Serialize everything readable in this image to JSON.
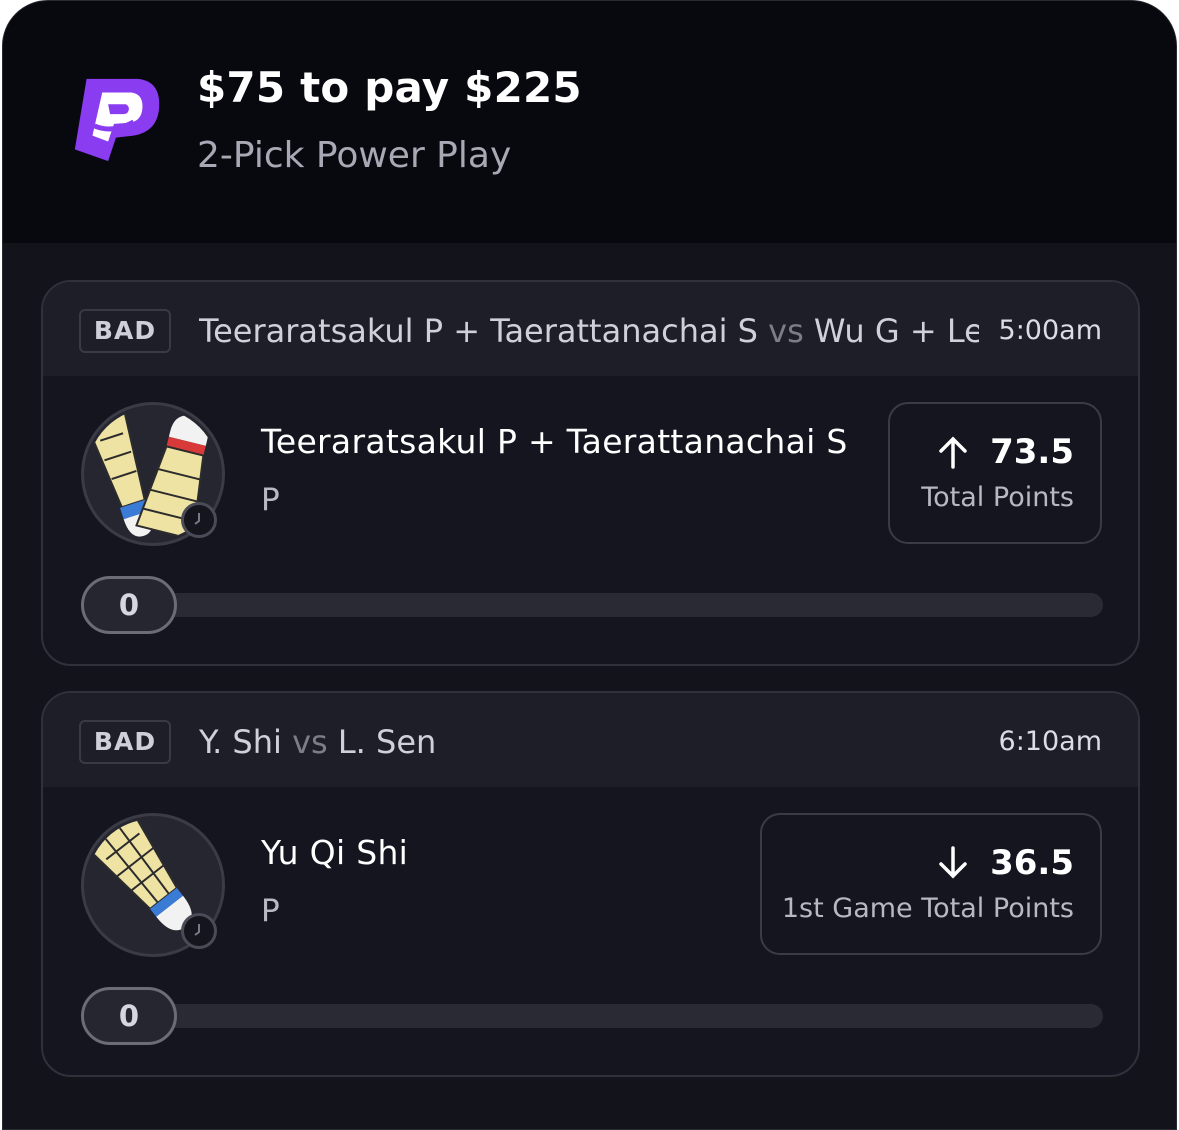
{
  "entry": {
    "title": "$75 to pay $225",
    "subtitle": "2-Pick Power Play"
  },
  "picks": [
    {
      "sport": "BAD",
      "team_a": "Teeraratsakul P + Taerattanachai S",
      "vs": "vs",
      "team_b": "Wu G + Le",
      "time": "5:00am",
      "player": "Teeraratsakul P + Taerattanachai S",
      "position": "P",
      "direction": "up",
      "line": "73.5",
      "stat": "Total Points",
      "progress": "0",
      "progress_fraction": 0
    },
    {
      "sport": "BAD",
      "team_a": "Y. Shi",
      "vs": "vs",
      "team_b": "L. Sen",
      "time": "6:10am",
      "player": "Yu Qi Shi",
      "position": "P",
      "direction": "down",
      "line": "36.5",
      "stat": "1st Game Total Points",
      "progress": "0",
      "progress_fraction": 0
    }
  ],
  "colors": {
    "brand": "#8a3cf0",
    "background": "#13131c",
    "header": "#08080f"
  },
  "icons": [
    "prizepicks-logo-icon",
    "shuttlecock-icon",
    "clock-icon",
    "arrow-up-icon",
    "arrow-down-icon"
  ]
}
